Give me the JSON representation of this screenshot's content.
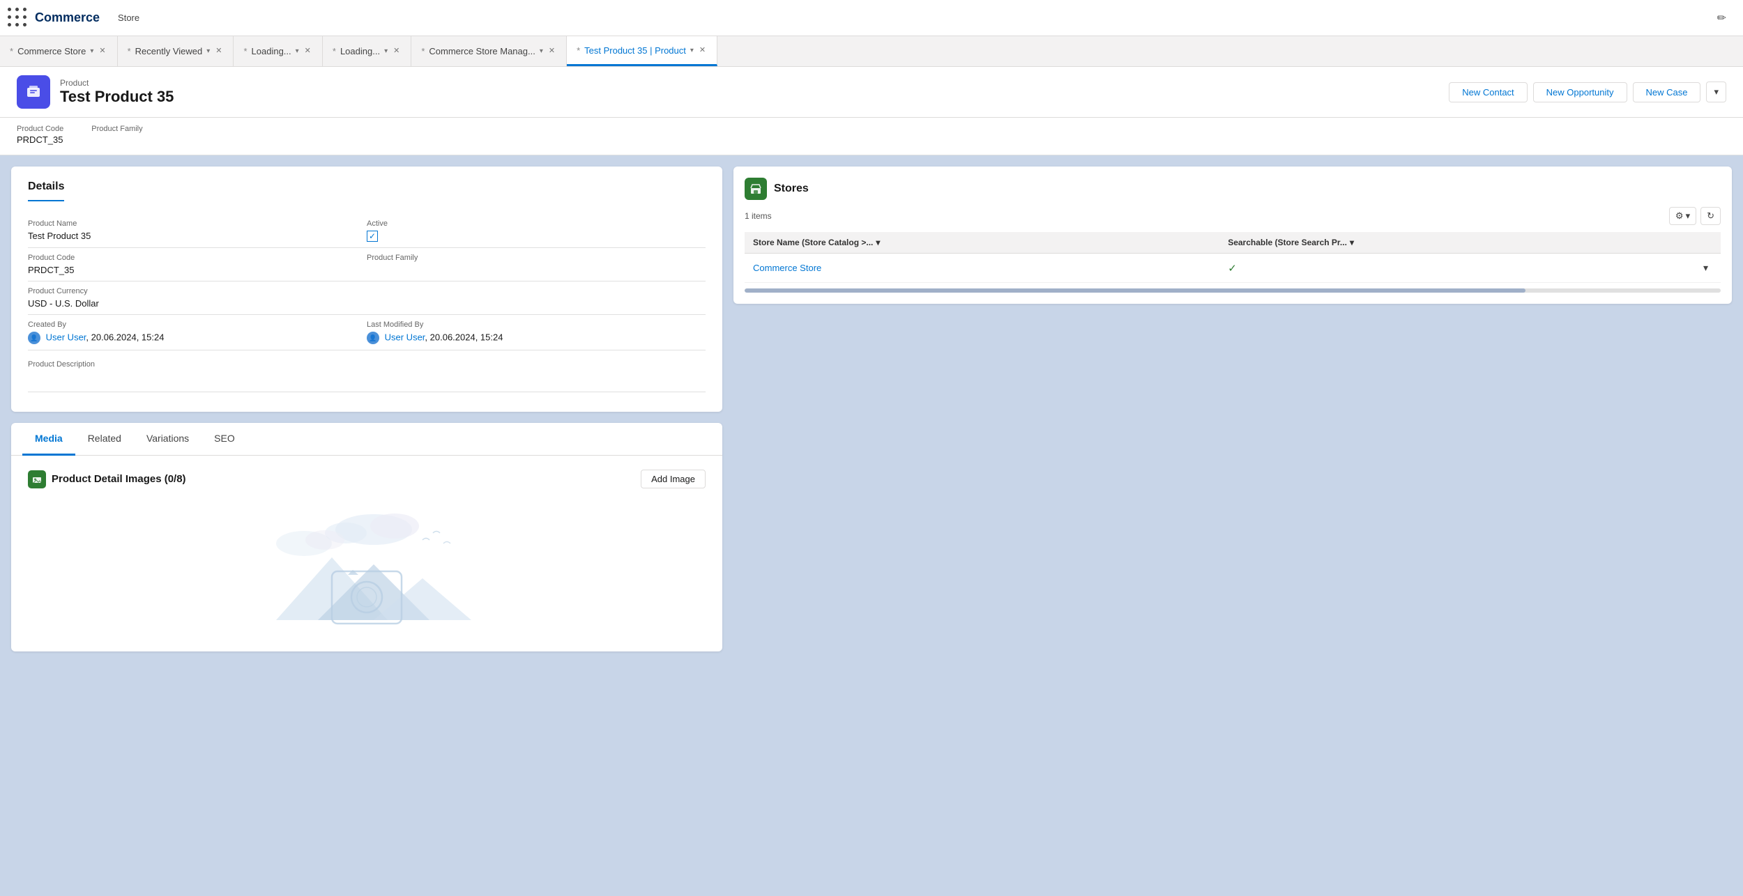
{
  "app": {
    "name": "Commerce",
    "nav_link": "Store"
  },
  "tabs": [
    {
      "id": "commerce-store",
      "label": "Commerce Store",
      "active": false,
      "modified": true,
      "closeable": true
    },
    {
      "id": "recently-viewed",
      "label": "Recently Viewed",
      "active": false,
      "modified": true,
      "closeable": true
    },
    {
      "id": "loading-1",
      "label": "Loading...",
      "active": false,
      "modified": true,
      "closeable": true
    },
    {
      "id": "loading-2",
      "label": "Loading...",
      "active": false,
      "modified": true,
      "closeable": true
    },
    {
      "id": "commerce-store-manag",
      "label": "Commerce Store Manag...",
      "active": false,
      "modified": true,
      "closeable": true
    },
    {
      "id": "test-product",
      "label": "Test Product 35 | Product",
      "active": true,
      "modified": true,
      "closeable": true
    }
  ],
  "record": {
    "type": "Product",
    "title": "Test Product 35",
    "icon": "📦",
    "meta": {
      "product_code_label": "Product Code",
      "product_code_value": "PRDCT_35",
      "product_family_label": "Product Family",
      "product_family_value": ""
    },
    "actions": {
      "new_contact": "New Contact",
      "new_opportunity": "New Opportunity",
      "new_case": "New Case",
      "dropdown_label": "▾"
    }
  },
  "details": {
    "section_title": "Details",
    "fields": {
      "product_name_label": "Product Name",
      "product_name_value": "Test Product 35",
      "active_label": "Active",
      "active_checked": true,
      "product_code_label": "Product Code",
      "product_code_value": "PRDCT_35",
      "product_family_label": "Product Family",
      "product_family_value": "",
      "product_currency_label": "Product Currency",
      "product_currency_value": "USD - U.S. Dollar",
      "created_by_label": "Created By",
      "created_by_user": "User User",
      "created_by_date": ", 20.06.2024, 15:24",
      "last_modified_label": "Last Modified By",
      "last_modified_user": "User User",
      "last_modified_date": ", 20.06.2024, 15:24",
      "description_label": "Product Description",
      "description_value": ""
    }
  },
  "bottom_tabs": {
    "tabs": [
      {
        "id": "media",
        "label": "Media",
        "active": true
      },
      {
        "id": "related",
        "label": "Related",
        "active": false
      },
      {
        "id": "variations",
        "label": "Variations",
        "active": false
      },
      {
        "id": "seo",
        "label": "SEO",
        "active": false
      }
    ],
    "media": {
      "subsection_title": "Product Detail Images (0/8)",
      "add_image_btn": "Add Image"
    }
  },
  "stores": {
    "title": "Stores",
    "items_count": "1 items",
    "gear_icon": "⚙",
    "refresh_icon": "↻",
    "table": {
      "col1_label": "Store Name (Store Catalog >...",
      "col2_label": "Searchable (Store Search Pr...",
      "rows": [
        {
          "store_name": "Commerce Store",
          "searchable": true,
          "has_row_action": true
        }
      ]
    }
  }
}
